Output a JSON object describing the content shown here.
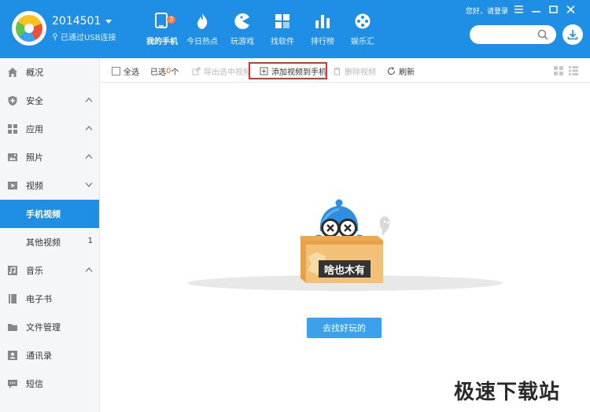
{
  "header": {
    "device_name": "2014501",
    "connection_status": "已通过USB连接",
    "greeting": "您好，请登录",
    "search_placeholder": "",
    "nav": [
      {
        "label": "我的手机",
        "icon": "phone-icon",
        "badge": "3",
        "active": true
      },
      {
        "label": "今日热点",
        "icon": "flame-icon"
      },
      {
        "label": "玩游戏",
        "icon": "pacman-icon"
      },
      {
        "label": "找软件",
        "icon": "apps-grid-icon"
      },
      {
        "label": "排行榜",
        "icon": "bar-chart-icon"
      },
      {
        "label": "娱乐汇",
        "icon": "film-reel-icon"
      }
    ]
  },
  "sidebar": {
    "items": [
      {
        "label": "概况",
        "icon": "home-icon"
      },
      {
        "label": "安全",
        "icon": "shield-icon"
      },
      {
        "label": "应用",
        "icon": "apps-icon"
      },
      {
        "label": "照片",
        "icon": "photo-icon"
      },
      {
        "label": "视频",
        "icon": "video-icon"
      },
      {
        "label": "手机视频",
        "active": true
      },
      {
        "label": "其他视频",
        "count": "1"
      },
      {
        "label": "音乐",
        "icon": "music-icon"
      },
      {
        "label": "电子书",
        "icon": "ebook-icon"
      },
      {
        "label": "文件管理",
        "icon": "folder-icon"
      },
      {
        "label": "通讯录",
        "icon": "contacts-icon"
      },
      {
        "label": "短信",
        "icon": "sms-icon"
      }
    ]
  },
  "toolbar": {
    "select_all": "全选",
    "selected_prefix": "已选",
    "selected_count": "0",
    "selected_suffix": "个",
    "export": "导出选中视频",
    "add": "添加视频到手机",
    "delete": "删除视频",
    "refresh": "刷新"
  },
  "empty_state": {
    "box_text": "啥也木有",
    "button": "去找好玩的"
  },
  "watermark": "极速下载站",
  "colors": {
    "primary": "#1f8fe6",
    "highlight": "#d9352a",
    "orange": "#f37021"
  }
}
